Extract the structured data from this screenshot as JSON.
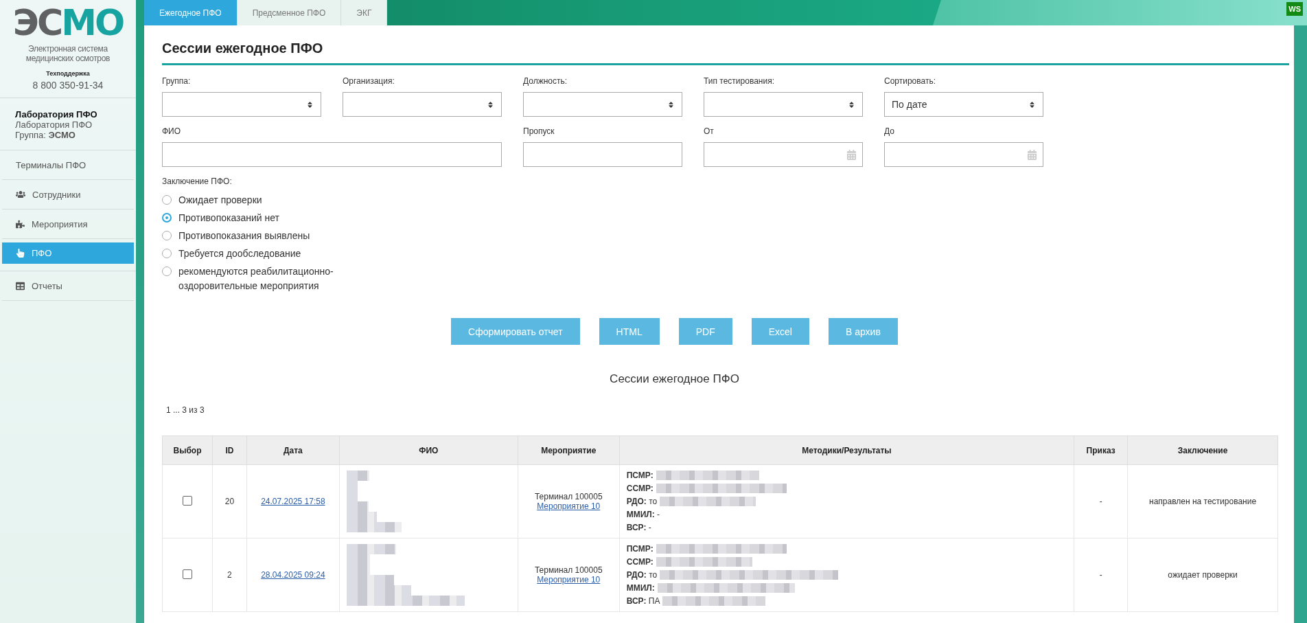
{
  "sidebar": {
    "logo": {
      "lead": "ЭС",
      "accent": "МО",
      "subtitle_lines": [
        "Электронная система",
        "медицинских осмотров"
      ]
    },
    "support_label": "Техподдержка",
    "phone": "8 800 350-91-34",
    "user": {
      "name": "Лаборатория ПФО",
      "org": "Лаборатория ПФО",
      "group_label": "Группа:",
      "group": "ЭСМО"
    },
    "items": [
      {
        "label": "Терминалы ПФО",
        "kind": "plain",
        "selected": false
      },
      {
        "label": "Сотрудники",
        "kind": "users",
        "selected": false
      },
      {
        "label": "Мероприятия",
        "kind": "puzzle",
        "selected": false
      },
      {
        "label": "ПФО",
        "kind": "hand",
        "selected": true
      },
      {
        "label": "Отчеты",
        "kind": "table",
        "selected": false
      }
    ]
  },
  "tabs": [
    {
      "label": "Ежегодное ПФО",
      "selected": true
    },
    {
      "label": "Предсменное ПФО",
      "selected": false
    },
    {
      "label": "ЭКГ",
      "selected": false
    }
  ],
  "user_badge": "WS",
  "page_title": "Сессии ежегодное ПФО",
  "filters": [
    {
      "label": "Группа:",
      "kind": "select"
    },
    {
      "label": "Организация:",
      "kind": "select"
    },
    {
      "label": "Должность:",
      "kind": "select"
    },
    {
      "label": "Тип тестирования:",
      "kind": "select"
    },
    {
      "label": "Сортировать:",
      "kind": "select",
      "value": "По дате"
    },
    {
      "label": "ФИО",
      "kind": "wide"
    },
    {
      "label": "Пропуск",
      "kind": "text"
    },
    {
      "label": "От",
      "kind": "date"
    },
    {
      "label": "До",
      "kind": "date"
    }
  ],
  "conclusion_filter": {
    "label": "Заключение ПФО:",
    "options": [
      {
        "label": "Ожидает проверки",
        "selected": false
      },
      {
        "label": "Противопоказаний нет",
        "selected": true
      },
      {
        "label": "Противопоказания выявлены",
        "selected": false
      },
      {
        "label": "Требуется дообследование",
        "selected": false
      },
      {
        "label": "рекомендуются реабилитационно-оздоровительные мероприятия",
        "selected": false
      }
    ]
  },
  "buttons": [
    "Сформировать отчет",
    "HTML",
    "PDF",
    "Excel",
    "В архив"
  ],
  "table_title": "Сессии ежегодное ПФО",
  "pagination": "1 ... 3 из 3",
  "table": {
    "columns": [
      "Выбор",
      "ID",
      "Дата",
      "ФИО",
      "Мероприятие",
      "Методики/Результаты",
      "Приказ",
      "Заключение"
    ],
    "rows": [
      {
        "checked": false,
        "id": "20",
        "date": "24.07.2025 17:58",
        "fio_redacted": true,
        "terminal": "Терминал 100005",
        "event": "Мероприятие 10",
        "methods": [
          {
            "text": "**ПСМР:**",
            "redacted": true
          },
          {
            "text": "**ССМР:**",
            "redacted": true
          },
          {
            "text": "**РДО:** то",
            "redacted": true
          },
          {
            "text": "**ММИЛ:** -",
            "redacted": false
          },
          {
            "text": "**ВСР:** -",
            "redacted": false
          }
        ],
        "order": "-",
        "conclusion": "направлен на тестирование"
      },
      {
        "checked": false,
        "id": "2",
        "date": "28.04.2025 09:24",
        "fio_redacted": true,
        "terminal": "Терминал 100005",
        "event": "Мероприятие 10",
        "methods": [
          {
            "text": "**ПСМР:**",
            "redacted": true
          },
          {
            "text": "**ССМР:**",
            "redacted": true
          },
          {
            "text": "**РДО:** то",
            "redacted": true
          },
          {
            "text": "**ММИЛ:**",
            "redacted": true
          },
          {
            "text": "**ВСР:** ПА",
            "redacted": true
          }
        ],
        "order": "-",
        "conclusion": "ожидает проверки"
      }
    ]
  }
}
